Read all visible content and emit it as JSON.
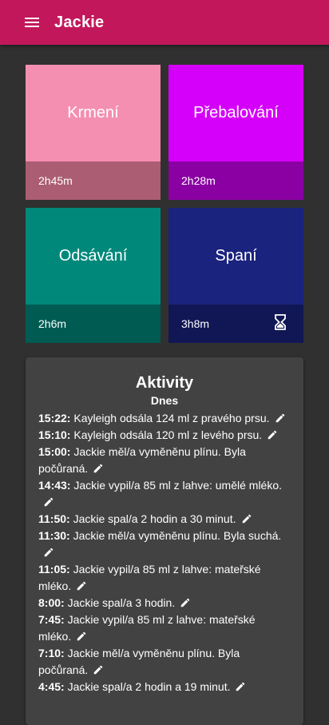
{
  "appbar": {
    "title": "Jackie",
    "menu_icon": "menu-icon",
    "color": "#c2185b"
  },
  "tiles": [
    {
      "label": "Krmení",
      "time": "2h45m",
      "top_color": "#f48fb1",
      "bottom_color": "#ab5d73"
    },
    {
      "label": "Přebalování",
      "time": "2h28m",
      "top_color": "#d500f9",
      "bottom_color": "#8a00a3"
    },
    {
      "label": "Odsávání",
      "time": "2h6m",
      "top_color": "#00897b",
      "bottom_color": "#005b52"
    },
    {
      "label": "Spaní",
      "time": "3h8m",
      "top_color": "#1a237e",
      "bottom_color": "#111754",
      "icon": "hourglass-icon"
    }
  ],
  "activities": {
    "title": "Aktivity",
    "day": "Dnes",
    "entries": [
      {
        "time": "15:22:",
        "text": "Kayleigh odsála 124 ml z pravého prsu."
      },
      {
        "time": "15:10:",
        "text": "Kayleigh odsála 120 ml z levého prsu."
      },
      {
        "time": "15:00:",
        "text": "Jackie měl/a vyměněnu plínu. Byla počůraná."
      },
      {
        "time": "14:43:",
        "text": "Jackie vypil/a 85 ml z lahve: umělé mléko."
      },
      {
        "time": "11:50:",
        "text": "Jackie spal/a 2 hodin a 30 minut."
      },
      {
        "time": "11:30:",
        "text": "Jackie měl/a vyměněnu plínu. Byla suchá."
      },
      {
        "time": "11:05:",
        "text": "Jackie vypil/a 85 ml z lahve: mateřské mléko."
      },
      {
        "time": "8:00:",
        "text": "Jackie spal/a 3 hodin."
      },
      {
        "time": "7:45:",
        "text": "Jackie vypil/a 85 ml z lahve: mateřské mléko."
      },
      {
        "time": "7:10:",
        "text": "Jackie měl/a vyměněnu plínu. Byla počůraná."
      },
      {
        "time": "4:45:",
        "text": "Jackie spal/a 2 hodin a 19 minut."
      }
    ]
  }
}
